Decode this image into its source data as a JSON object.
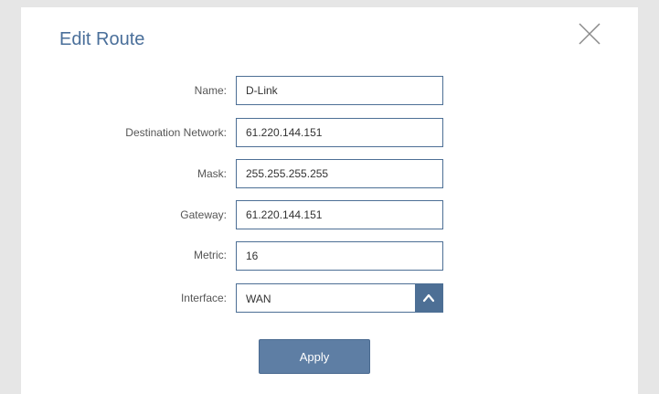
{
  "dialog": {
    "title": "Edit Route",
    "close_icon": "close-icon"
  },
  "form": {
    "name": {
      "label": "Name:",
      "value": "D-Link"
    },
    "destination_network": {
      "label": "Destination Network:",
      "value": "61.220.144.151"
    },
    "mask": {
      "label": "Mask:",
      "value": "255.255.255.255"
    },
    "gateway": {
      "label": "Gateway:",
      "value": "61.220.144.151"
    },
    "metric": {
      "label": "Metric:",
      "value": "16"
    },
    "interface": {
      "label": "Interface:",
      "value": "WAN",
      "icon": "chevron-up-icon"
    }
  },
  "actions": {
    "apply_label": "Apply"
  },
  "colors": {
    "title": "#4a6f9a",
    "field_border": "#4d6f95",
    "button": "#5e7ea4"
  }
}
